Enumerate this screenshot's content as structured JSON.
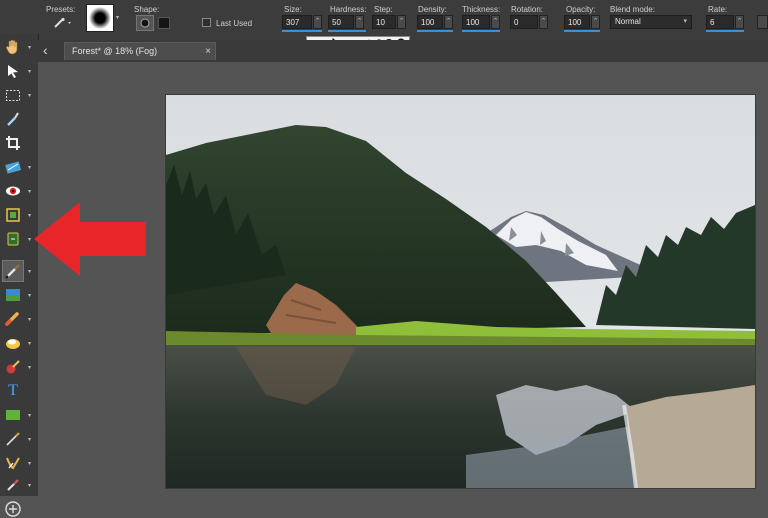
{
  "options_bar": {
    "presets_label": "Presets:",
    "shape_label": "Shape:",
    "last_used_label": "Last Used",
    "size_label": "Size:",
    "size_value": "307",
    "hardness_label": "Hardness:",
    "hardness_value": "50",
    "step_label": "Step:",
    "step_value": "10",
    "density_label": "Density:",
    "density_value": "100",
    "thickness_label": "Thickness:",
    "thickness_value": "100",
    "rotation_label": "Rotation:",
    "rotation_value": "0",
    "opacity_label": "Opacity:",
    "opacity_value": "100",
    "blend_mode_label": "Blend mode:",
    "blend_mode_value": "Normal",
    "rate_label": "Rate:",
    "rate_value": "6",
    "accent_color": "#3b8fd6"
  },
  "document_tab": {
    "title": "Forest* @  18% (Fog)",
    "close_glyph": "×",
    "back_glyph": "‹"
  },
  "toolbox": {
    "tools": [
      "pan-icon",
      "pick-icon",
      "selection-icon",
      "dropper-icon",
      "crop-icon",
      "straighten-icon",
      "red-eye-icon",
      "transform-icon",
      "brush-icon",
      "fill-icon",
      "paint-icon",
      "eraser-icon",
      "blur-icon",
      "text-icon",
      "shape-icon",
      "draw-icon",
      "scratch-icon",
      "retouch-icon",
      "add-icon"
    ],
    "selected_tool": "brush-icon",
    "text_tool_glyph": "T",
    "add_glyph": "⊕"
  },
  "annotation": {
    "arrow_color": "#e8262a"
  }
}
